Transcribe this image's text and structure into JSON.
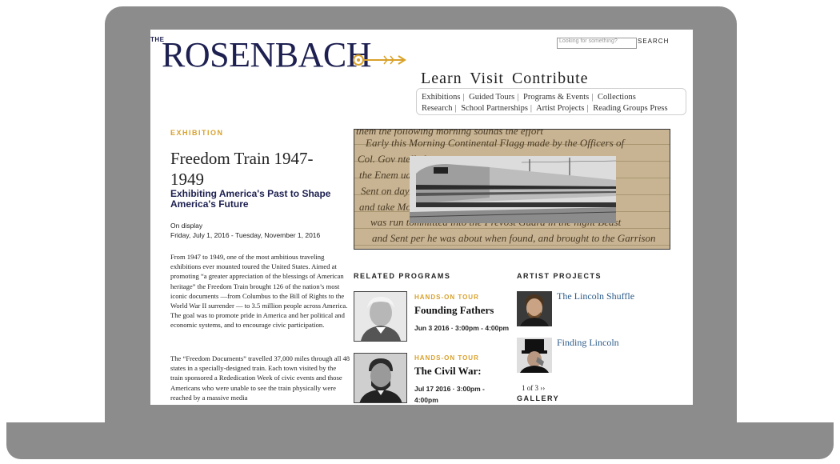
{
  "header": {
    "logo_the": "THE",
    "logo_name": "ROSENBACH",
    "search_placeholder": "Looking for something?",
    "search_button": "SEARCH",
    "main_nav": "Learn Visit Contribute",
    "sub_nav_row1": [
      "Exhibitions",
      "Guided Tours",
      "Programs & Events",
      "Collections"
    ],
    "sub_nav_row2": [
      "Research",
      "School Partnerships",
      "Artist Projects",
      "Reading Groups",
      "Press"
    ]
  },
  "exhibition": {
    "eyebrow": "EXHIBITION",
    "title": "Freedom Train 1947-1949",
    "subtitle": "Exhibiting America's Past to Shape America's Future",
    "on_display_label": "On display",
    "dates": "Friday, July 1, 2016 - Tuesday, November 1, 2016",
    "paragraph1": "From 1947 to 1949, one of the most ambitious traveling exhibitions ever mounted toured the United States.  Aimed at promoting “a greater appreciation of the blessings of American heritage” the Freedom Train brought 126 of the nation’s most iconic documents —from Columbus to the Bill of Rights to the World War II surrender — to 3.5 million people across America.  The goal was to promote pride in America and her political and economic systems, and to encourage civic participation.",
    "paragraph2": "The “Freedom Documents” travelled 37,000 miles through all 48 states in a specially-designed train. Each town visited by the train sponsored a Rededication Week of civic events and those Americans who were unable to  see the train physically were reached by a massive media"
  },
  "hero": {
    "script_lines": [
      "them the following morning sounds the effort",
      "Early this Morning Continental Flagg made by the Officers of",
      "Col. Gov                                    ntelled at",
      "the Enem                                     uarty war-",
      "Sent on                                       day of",
      "and take                                     Month that",
      "was run tommitted into the Prevost Guard in the night Beast",
      "and Sent per he was about when found, and brought to the Garrison"
    ],
    "train_label": "Freedom Train locomotive"
  },
  "related_programs": {
    "heading": "RELATED PROGRAMS",
    "items": [
      {
        "tag": "HANDS-ON TOUR",
        "title": "Founding Fathers",
        "date": "Jun 3 2016 · 3:00pm - 4:00pm"
      },
      {
        "tag": "HANDS-ON TOUR",
        "title": "The Civil War:",
        "date": "Jul 17 2016 · 3:00pm - 4:00pm"
      }
    ]
  },
  "artist_projects": {
    "heading": "ARTIST PROJECTS",
    "items": [
      {
        "title": "The Lincoln Shuffle"
      },
      {
        "title": "Finding Lincoln"
      }
    ],
    "pager": "1 of 3  ››",
    "gallery_heading": "GALLERY"
  },
  "colors": {
    "gold": "#d9a12a",
    "navy": "#1d2050",
    "link": "#2e5c8a",
    "laptop_frame": "#8c8c8c"
  }
}
